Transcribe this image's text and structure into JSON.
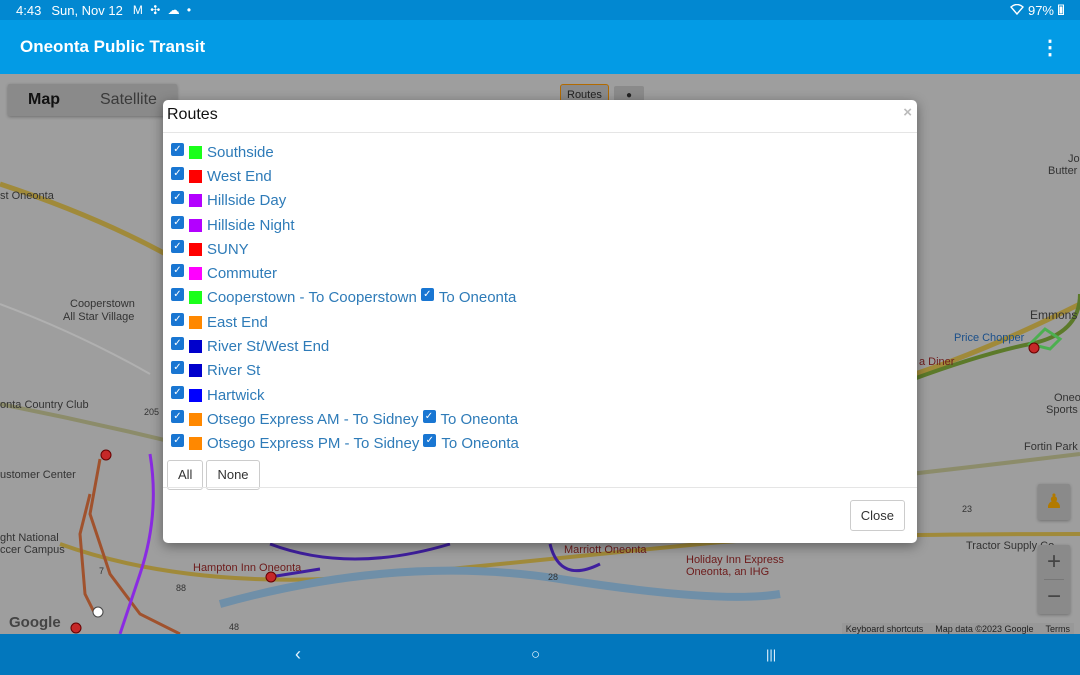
{
  "status_bar": {
    "time": "4:43",
    "date": "Sun, Nov 12",
    "notification_icons": "M ✣ ☁ •",
    "battery": "97%"
  },
  "app_bar": {
    "title": "Oneonta Public Transit",
    "menu_icon": "⋮"
  },
  "map": {
    "map_type": {
      "map": "Map",
      "satellite": "Satellite"
    },
    "routes_control": "Routes",
    "labels": {
      "west_oneonta": "st Oneonta",
      "cooperstown_village_1": "Cooperstown",
      "cooperstown_village_2": "All Star Village",
      "country_club": "onta Country Club",
      "customer_center": "ustomer Center",
      "national_1": "ght National",
      "national_2": "ccer Campus",
      "hampton": "Hampton Inn Oneonta",
      "marriott": "Marriott Oneonta",
      "holiday_1": "Holiday Inn Express",
      "holiday_2": "Oneonta, an IHG",
      "price_chopper": "Price Chopper",
      "diner": "a Diner",
      "emmons": "Emmons",
      "fortin": "Fortin Park",
      "tractor": "Tractor Supply Co",
      "oneonta_sports_1": "Oneo",
      "oneonta_sports_2": "Sports",
      "butter_1": "Jo",
      "butter_2": "Butter",
      "road_205": "205",
      "road_28": "28",
      "road_23": "23",
      "road_48": "48",
      "road_88": "88",
      "road_7": "7"
    },
    "zoom_in": "+",
    "zoom_out": "−",
    "google": "Google",
    "attribution": [
      "Keyboard shortcuts",
      "Map data ©2023 Google",
      "Terms"
    ]
  },
  "modal": {
    "title": "Routes",
    "close_x": "×",
    "routes": [
      {
        "label": "Southside",
        "color": "#1aff1a"
      },
      {
        "label": "West End",
        "color": "#ff0000"
      },
      {
        "label": "Hillside Day",
        "color": "#b300ff"
      },
      {
        "label": "Hillside Night",
        "color": "#b300ff"
      },
      {
        "label": "SUNY",
        "color": "#ff0000"
      },
      {
        "label": "Commuter",
        "color": "#ff00ff"
      },
      {
        "label": "Cooperstown - To Cooperstown",
        "color": "#1aff1a",
        "sub_label": "To Oneonta"
      },
      {
        "label": "East End",
        "color": "#ff8800"
      },
      {
        "label": "River St/West End",
        "color": "#0000cc"
      },
      {
        "label": "River St",
        "color": "#0000cc"
      },
      {
        "label": "Hartwick",
        "color": "#0000ff"
      },
      {
        "label": "Otsego Express AM - To Sidney",
        "color": "#ff8800",
        "sub_label": "To Oneonta"
      },
      {
        "label": "Otsego Express PM - To Sidney",
        "color": "#ff8800",
        "sub_label": "To Oneonta"
      }
    ],
    "all_label": "All",
    "none_label": "None",
    "close_label": "Close"
  },
  "nav_bar": {
    "back_icon": "‹",
    "home_icon": "○",
    "recents_icon": "|||"
  }
}
